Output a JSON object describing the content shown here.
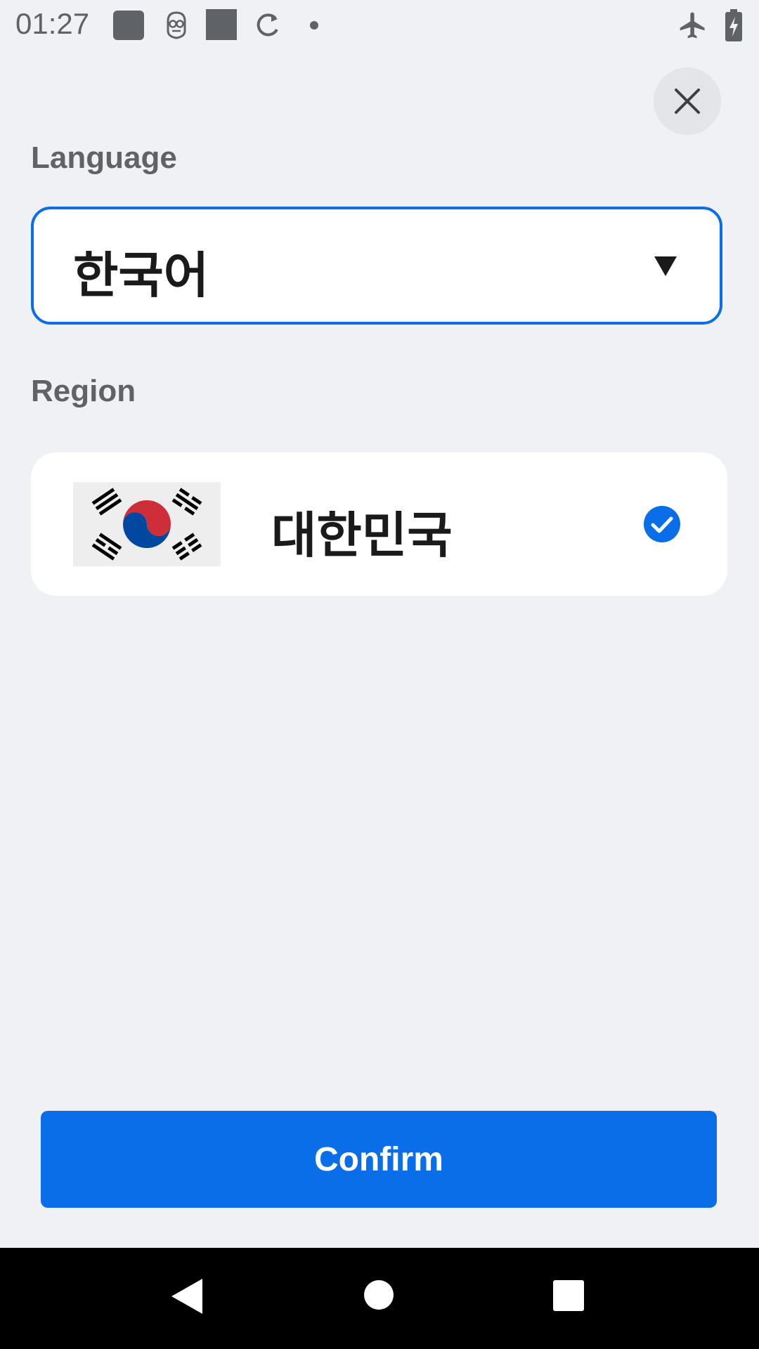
{
  "status_bar": {
    "time": "01:27",
    "icons": [
      "square-notification-icon",
      "android-debug-icon",
      "square-notification-icon",
      "sync-icon",
      "dot-icon",
      "airplane-mode-icon",
      "battery-charging-icon"
    ]
  },
  "close_icon": "close-icon",
  "language": {
    "label": "Language",
    "selected_value": "한국어",
    "dropdown_icon": "caret-down-icon"
  },
  "region": {
    "label": "Region",
    "items": [
      {
        "name": "대한민국",
        "flag_icon": "south-korea-flag-icon",
        "selected": true
      }
    ]
  },
  "confirm_label": "Confirm",
  "colors": {
    "accent": "#0a6ee8",
    "background": "#eff1f4",
    "card": "#ffffff",
    "label": "#5f6368"
  },
  "nav_bar": {
    "icons": [
      "back-icon",
      "home-icon",
      "recents-icon"
    ]
  }
}
